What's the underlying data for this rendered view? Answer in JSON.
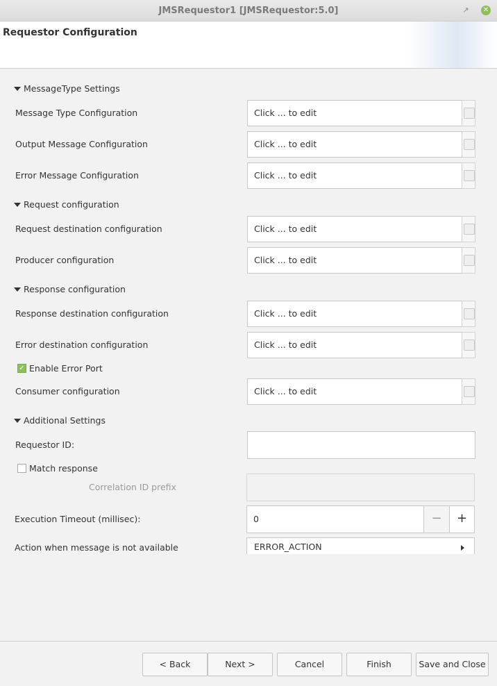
{
  "window": {
    "title": "JMSRequestor1 [JMSRequestor:5.0]",
    "restore_glyph": "↗",
    "close_glyph": "✕"
  },
  "header": {
    "title": "Requestor Configuration"
  },
  "edit_placeholder": "Click ... to edit",
  "sections": {
    "message_type": {
      "title": "MessageType Settings",
      "fields": [
        {
          "label": "Message Type Configuration",
          "value": "Click ... to edit"
        },
        {
          "label": "Output Message Configuration",
          "value": "Click ... to edit"
        },
        {
          "label": "Error Message Configuration",
          "value": "Click ... to edit"
        }
      ]
    },
    "request": {
      "title": "Request configuration",
      "fields": [
        {
          "label": "Request destination configuration",
          "value": "Click ... to edit"
        },
        {
          "label": "Producer configuration",
          "value": "Click ... to edit"
        }
      ]
    },
    "response": {
      "title": "Response configuration",
      "fields": [
        {
          "label": "Response destination configuration",
          "value": "Click ... to edit"
        },
        {
          "label": "Error destination configuration",
          "value": "Click ... to edit"
        },
        {
          "label": "Consumer configuration",
          "value": "Click ... to edit"
        }
      ],
      "enable_error_port": {
        "label": "Enable Error Port",
        "checked": true
      }
    },
    "additional": {
      "title": "Additional Settings",
      "requestor_id_label": "Requestor ID:",
      "requestor_id_value": "",
      "match_response": {
        "label": "Match response",
        "checked": false
      },
      "correlation_label": "Correlation ID prefix",
      "timeout_label": "Execution Timeout (millisec):",
      "timeout_value": "0",
      "action_label": "Action when message is not available",
      "action_value": "ERROR_ACTION"
    }
  },
  "footer": {
    "back": "< Back",
    "next": "Next >",
    "cancel": "Cancel",
    "finish": "Finish",
    "save_close": "Save and Close"
  },
  "colors": {
    "accent": "#8fbf5b",
    "background": "#f2f2f2"
  }
}
